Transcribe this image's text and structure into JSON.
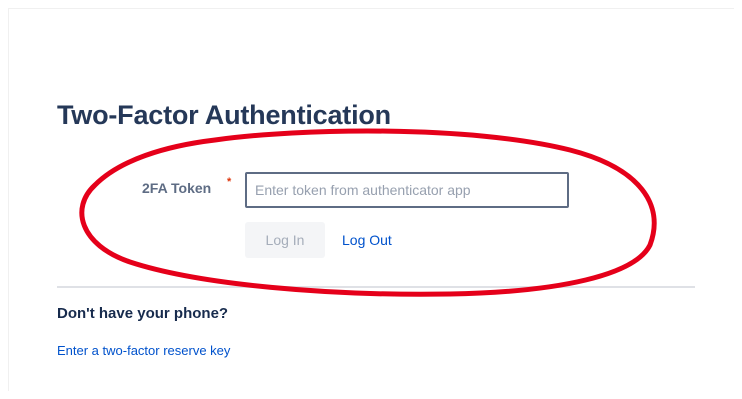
{
  "page": {
    "title": "Two-Factor Authentication"
  },
  "form": {
    "token_label": "2FA Token",
    "required_marker": "*",
    "token_placeholder": "Enter token from authenticator app",
    "token_value": "",
    "login_button_label": "Log In",
    "logout_link_label": "Log Out"
  },
  "recovery": {
    "heading": "Don't have your phone?",
    "reserve_key_link": "Enter a two-factor reserve key"
  },
  "annotation": {
    "ellipse_color": "#e5001a"
  }
}
